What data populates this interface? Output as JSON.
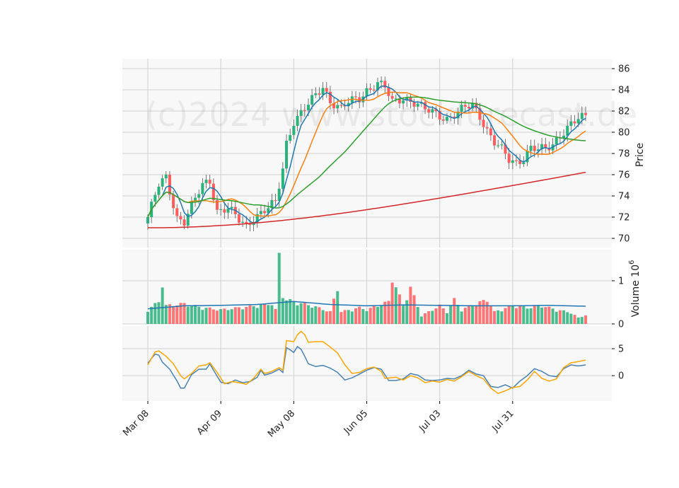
{
  "chart_data": {
    "type": "candlestick",
    "watermark": "(c)2024 www.stockforecast.de",
    "colors": {
      "up": "#2ab27b",
      "down": "#ff5c5c",
      "ma_short": "#1f77b4",
      "ma_mid": "#ff7f0e",
      "ma_long": "#2ca02c",
      "ma_200": "#d62728",
      "volume_ma": "#1f77b4",
      "macd": "#4682b4",
      "signal": "#ffa500",
      "panel_bg": "#f8f8f8",
      "grid": "#d0d0d0"
    },
    "x_ticks": [
      {
        "label": "Mar 08",
        "i": 0
      },
      {
        "label": "Apr 09",
        "i": 20
      },
      {
        "label": "May 08",
        "i": 40
      },
      {
        "label": "Jun 05",
        "i": 60
      },
      {
        "label": "Jul 03",
        "i": 80
      },
      {
        "label": "Jul 31",
        "i": 100
      }
    ],
    "n_sessions": 121,
    "price_panel": {
      "ylabel": "Price",
      "ylim": [
        69.4,
        86.6
      ],
      "yticks": [
        70,
        72,
        74,
        76,
        78,
        80,
        82,
        84,
        86
      ]
    },
    "volume_panel": {
      "ylabel": "Volume  10",
      "ylabel_exp": "6",
      "ylim": [
        0,
        1.72
      ],
      "yticks": [
        0,
        1
      ]
    },
    "macd_panel": {
      "ylim": [
        -4.7,
        9.2
      ],
      "yticks": [
        0,
        5
      ]
    },
    "price_anchors": [
      [
        0,
        72.0
      ],
      [
        3,
        75.0
      ],
      [
        5,
        75.7
      ],
      [
        8,
        72.0
      ],
      [
        10,
        71.6
      ],
      [
        12,
        73.0
      ],
      [
        15,
        75.0
      ],
      [
        17,
        75.5
      ],
      [
        19,
        72.6
      ],
      [
        22,
        72.8
      ],
      [
        25,
        71.7
      ],
      [
        27,
        71.2
      ],
      [
        29,
        72.0
      ],
      [
        32,
        72.6
      ],
      [
        35,
        73.3
      ],
      [
        37,
        76.6
      ],
      [
        38,
        79.0
      ],
      [
        40,
        81.1
      ],
      [
        42,
        81.8
      ],
      [
        45,
        83.0
      ],
      [
        48,
        84.3
      ],
      [
        50,
        83.0
      ],
      [
        53,
        82.2
      ],
      [
        55,
        82.8
      ],
      [
        58,
        83.2
      ],
      [
        60,
        84.0
      ],
      [
        63,
        84.6
      ],
      [
        65,
        84.2
      ],
      [
        67,
        82.8
      ],
      [
        70,
        83.3
      ],
      [
        73,
        82.8
      ],
      [
        76,
        82.1
      ],
      [
        79,
        81.8
      ],
      [
        82,
        81.3
      ],
      [
        85,
        81.8
      ],
      [
        87,
        82.3
      ],
      [
        89,
        82.6
      ],
      [
        91,
        81.6
      ],
      [
        93,
        80.2
      ],
      [
        95,
        79.0
      ],
      [
        97,
        78.3
      ],
      [
        99,
        77.4
      ],
      [
        101,
        77.2
      ],
      [
        103,
        77.6
      ],
      [
        105,
        78.5
      ],
      [
        107,
        78.3
      ],
      [
        109,
        78.4
      ],
      [
        111,
        78.9
      ],
      [
        113,
        79.8
      ],
      [
        116,
        80.7
      ],
      [
        118,
        81.2
      ],
      [
        120,
        81.5
      ]
    ],
    "volume_anchors": [
      [
        0,
        0.35
      ],
      [
        3,
        0.55
      ],
      [
        4,
        1.0
      ],
      [
        5,
        0.45
      ],
      [
        10,
        0.5
      ],
      [
        15,
        0.4
      ],
      [
        20,
        0.35
      ],
      [
        25,
        0.4
      ],
      [
        30,
        0.45
      ],
      [
        34,
        0.5
      ],
      [
        35,
        0.35
      ],
      [
        36,
        1.68
      ],
      [
        37,
        0.7
      ],
      [
        38,
        0.6
      ],
      [
        40,
        0.55
      ],
      [
        45,
        0.45
      ],
      [
        50,
        0.3
      ],
      [
        52,
        0.9
      ],
      [
        53,
        0.3
      ],
      [
        58,
        0.4
      ],
      [
        60,
        0.35
      ],
      [
        66,
        0.55
      ],
      [
        67,
        1.15
      ],
      [
        70,
        0.45
      ],
      [
        72,
        0.9
      ],
      [
        75,
        0.2
      ],
      [
        80,
        0.45
      ],
      [
        82,
        0.3
      ],
      [
        84,
        0.6
      ],
      [
        86,
        0.35
      ],
      [
        90,
        0.5
      ],
      [
        93,
        0.6
      ],
      [
        95,
        0.3
      ],
      [
        100,
        0.45
      ],
      [
        104,
        0.4
      ],
      [
        108,
        0.45
      ],
      [
        112,
        0.35
      ],
      [
        116,
        0.28
      ],
      [
        118,
        0.15
      ],
      [
        120,
        0.22
      ]
    ],
    "volume_ma_anchors": [
      [
        0,
        0.35
      ],
      [
        10,
        0.42
      ],
      [
        20,
        0.43
      ],
      [
        30,
        0.45
      ],
      [
        40,
        0.52
      ],
      [
        50,
        0.45
      ],
      [
        60,
        0.42
      ],
      [
        70,
        0.44
      ],
      [
        80,
        0.43
      ],
      [
        90,
        0.42
      ],
      [
        100,
        0.42
      ],
      [
        110,
        0.43
      ],
      [
        120,
        0.41
      ]
    ],
    "macd_anchors": [
      [
        0,
        2.3
      ],
      [
        1,
        3.2
      ],
      [
        2,
        4.0
      ],
      [
        3,
        3.8
      ],
      [
        4,
        2.5
      ],
      [
        6,
        1.2
      ],
      [
        8,
        -1.0
      ],
      [
        9,
        -2.3
      ],
      [
        10,
        -2.3
      ],
      [
        12,
        0.2
      ],
      [
        14,
        1.2
      ],
      [
        16,
        1.2
      ],
      [
        17,
        2.2
      ],
      [
        18,
        1.0
      ],
      [
        20,
        -1.2
      ],
      [
        22,
        -1.5
      ],
      [
        24,
        -0.8
      ],
      [
        26,
        -1.3
      ],
      [
        28,
        -1.1
      ],
      [
        30,
        -0.3
      ],
      [
        31,
        1.0
      ],
      [
        32,
        0.1
      ],
      [
        34,
        0.5
      ],
      [
        36,
        1.2
      ],
      [
        37,
        0.6
      ],
      [
        38,
        5.2
      ],
      [
        39,
        4.8
      ],
      [
        40,
        4.3
      ],
      [
        41,
        5.4
      ],
      [
        42,
        4.9
      ],
      [
        43,
        3.6
      ],
      [
        44,
        2.2
      ],
      [
        46,
        1.7
      ],
      [
        48,
        1.9
      ],
      [
        50,
        1.4
      ],
      [
        52,
        0.6
      ],
      [
        54,
        -0.8
      ],
      [
        56,
        -0.4
      ],
      [
        58,
        0.3
      ],
      [
        60,
        1.0
      ],
      [
        62,
        1.5
      ],
      [
        64,
        1.2
      ],
      [
        66,
        -0.9
      ],
      [
        68,
        -0.9
      ],
      [
        70,
        -0.6
      ],
      [
        72,
        0.4
      ],
      [
        74,
        0.1
      ],
      [
        76,
        -0.8
      ],
      [
        78,
        -0.9
      ],
      [
        80,
        -0.8
      ],
      [
        82,
        -0.5
      ],
      [
        84,
        -0.6
      ],
      [
        86,
        0.0
      ],
      [
        88,
        1.0
      ],
      [
        90,
        0.3
      ],
      [
        92,
        0.0
      ],
      [
        94,
        -2.0
      ],
      [
        96,
        -2.2
      ],
      [
        98,
        -1.7
      ],
      [
        100,
        -2.3
      ],
      [
        102,
        -1.0
      ],
      [
        104,
        0.0
      ],
      [
        106,
        1.3
      ],
      [
        108,
        0.8
      ],
      [
        110,
        0.0
      ],
      [
        112,
        -0.2
      ],
      [
        114,
        1.3
      ],
      [
        116,
        2.0
      ],
      [
        118,
        1.8
      ],
      [
        120,
        2.0
      ]
    ],
    "signal_anchors": [
      [
        0,
        2.0
      ],
      [
        2,
        4.4
      ],
      [
        3,
        4.6
      ],
      [
        5,
        3.6
      ],
      [
        7,
        2.2
      ],
      [
        9,
        0.0
      ],
      [
        10,
        -0.6
      ],
      [
        12,
        0.4
      ],
      [
        14,
        1.8
      ],
      [
        16,
        2.0
      ],
      [
        17,
        2.4
      ],
      [
        19,
        0.6
      ],
      [
        21,
        -1.5
      ],
      [
        23,
        -1.1
      ],
      [
        25,
        -1.3
      ],
      [
        27,
        -1.6
      ],
      [
        29,
        -0.5
      ],
      [
        31,
        1.2
      ],
      [
        32,
        0.4
      ],
      [
        34,
        0.8
      ],
      [
        36,
        1.5
      ],
      [
        37,
        1.0
      ],
      [
        38,
        6.5
      ],
      [
        40,
        6.3
      ],
      [
        41,
        7.6
      ],
      [
        42,
        8.2
      ],
      [
        43,
        7.6
      ],
      [
        44,
        6.2
      ],
      [
        46,
        6.3
      ],
      [
        48,
        6.3
      ],
      [
        50,
        5.3
      ],
      [
        52,
        4.2
      ],
      [
        54,
        2.0
      ],
      [
        56,
        0.4
      ],
      [
        58,
        0.6
      ],
      [
        60,
        1.3
      ],
      [
        62,
        1.6
      ],
      [
        64,
        0.8
      ],
      [
        65,
        -0.5
      ],
      [
        68,
        -0.3
      ],
      [
        70,
        -0.8
      ],
      [
        72,
        0.0
      ],
      [
        74,
        -0.4
      ],
      [
        76,
        -1.3
      ],
      [
        78,
        -1.0
      ],
      [
        80,
        -1.2
      ],
      [
        82,
        -0.7
      ],
      [
        84,
        -1.0
      ],
      [
        86,
        -0.2
      ],
      [
        88,
        0.8
      ],
      [
        90,
        0.0
      ],
      [
        92,
        -0.6
      ],
      [
        94,
        -2.3
      ],
      [
        96,
        -3.3
      ],
      [
        98,
        -2.8
      ],
      [
        100,
        -2.2
      ],
      [
        102,
        -2.0
      ],
      [
        104,
        -0.8
      ],
      [
        106,
        0.8
      ],
      [
        108,
        -0.5
      ],
      [
        110,
        -1.0
      ],
      [
        112,
        -0.6
      ],
      [
        114,
        1.5
      ],
      [
        116,
        2.4
      ],
      [
        118,
        2.6
      ],
      [
        120,
        2.9
      ]
    ]
  }
}
